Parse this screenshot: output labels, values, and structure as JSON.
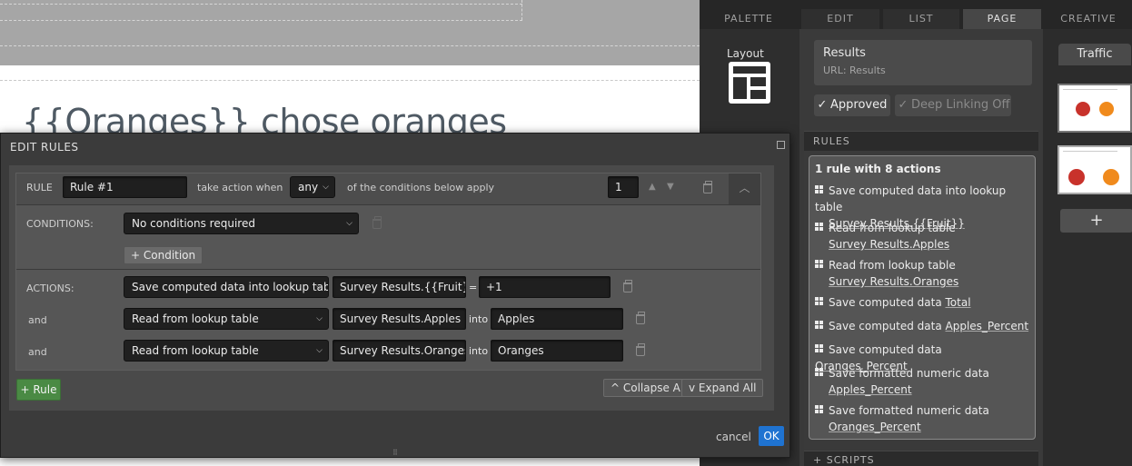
{
  "canvas": {
    "heading": "{{Oranges}} chose oranges"
  },
  "panel": {
    "tabs": [
      "PALETTE",
      "EDIT",
      "LIST",
      "PAGE",
      "CREATIVE"
    ],
    "layout_label": "Layout",
    "page_title": "Results",
    "page_url": "URL: Results",
    "approved_label": "Approved",
    "deep_linking_label": "Deep Linking Off",
    "rules_header": "RULES",
    "rules_summary": "1 rule with 8 actions",
    "rule_items": [
      {
        "text": "Save computed data into lookup table",
        "target": "Survey Results.{{Fruit}}"
      },
      {
        "text": "Read from lookup table",
        "target": "Survey Results.Apples"
      },
      {
        "text": "Read from lookup table",
        "target": "Survey Results.Oranges"
      },
      {
        "text": "Save computed data",
        "target": "Total"
      },
      {
        "text": "Save computed data",
        "target": "Apples_Percent"
      },
      {
        "text": "Save computed data",
        "target": "Oranges_Percent"
      },
      {
        "text": "Save formatted numeric data",
        "target": "Apples_Percent"
      },
      {
        "text": "Save formatted numeric data",
        "target": "Oranges_Percent"
      }
    ],
    "scripts_header": "+ SCRIPTS",
    "traffic_label": "Traffic",
    "add_page_label": "+"
  },
  "modal": {
    "title": "EDIT RULES",
    "rule_label": "RULE",
    "rule_name": "Rule #1",
    "take_action_text": "take action when",
    "match_mode": "any",
    "conditions_apply_text": "of the conditions below apply",
    "rule_order": "1",
    "conditions_label": "CONDITIONS:",
    "condition_select": "No conditions required",
    "add_condition_label": "+ Condition",
    "actions_label": "ACTIONS:",
    "and_label": "and",
    "actions": [
      {
        "type": "Save computed data into lookup table",
        "target": "Survey Results.{{Fruit}}",
        "connector": "=",
        "value": "+1"
      },
      {
        "type": "Read from lookup table",
        "target": "Survey Results.Apples",
        "connector": "into",
        "value": "Apples"
      },
      {
        "type": "Read from lookup table",
        "target": "Survey Results.Oranges",
        "connector": "into",
        "value": "Oranges"
      }
    ],
    "add_rule_label": "+ Rule",
    "collapse_all_label": "^ Collapse All",
    "expand_all_label": "v Expand All",
    "cancel_label": "cancel",
    "ok_label": "OK"
  }
}
